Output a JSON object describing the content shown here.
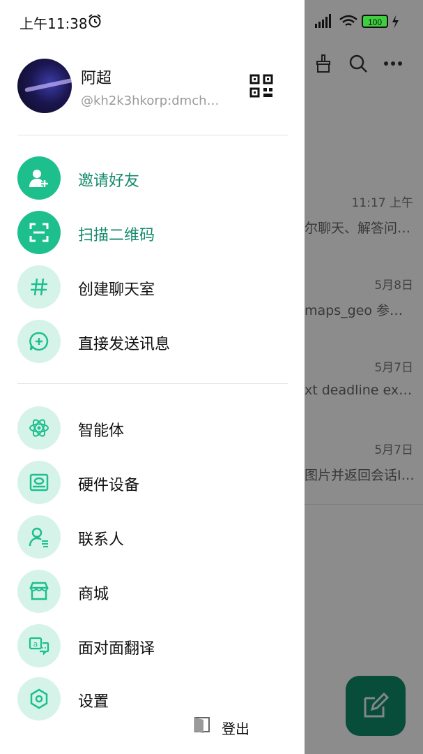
{
  "status_bar": {
    "time": "上午11:38",
    "battery": "100"
  },
  "profile": {
    "name": "阿超",
    "user_id": "@kh2k3hkorp:dmch…"
  },
  "menu_primary": [
    {
      "label": "邀请好友",
      "icon": "add-user-icon"
    },
    {
      "label": "扫描二维码",
      "icon": "scan-icon"
    },
    {
      "label": "创建聊天室",
      "icon": "hashtag-icon"
    },
    {
      "label": "直接发送讯息",
      "icon": "chat-plus-icon"
    }
  ],
  "menu_secondary": [
    {
      "label": "智能体",
      "icon": "atom-icon"
    },
    {
      "label": "硬件设备",
      "icon": "device-icon"
    },
    {
      "label": "联系人",
      "icon": "contacts-icon"
    },
    {
      "label": "商城",
      "icon": "store-icon"
    },
    {
      "label": "面对面翻译",
      "icon": "translate-icon"
    },
    {
      "label": "设置",
      "icon": "settings-icon"
    }
  ],
  "logout": {
    "label": "登出"
  },
  "background_list": [
    {
      "time": "11:17 上午",
      "preview": "尔聊天、解答问…"
    },
    {
      "time": "5月8日",
      "preview": "maps_geo 参…"
    },
    {
      "time": "5月7日",
      "preview": "xt deadline ex…"
    },
    {
      "time": "5月7日",
      "preview": "图片并返回会话I…"
    }
  ],
  "colors": {
    "accent": "#1dbf8c",
    "accent_text": "#158a6c",
    "icon_bg": "#d6f3ea",
    "fab": "#0f8a6b"
  }
}
